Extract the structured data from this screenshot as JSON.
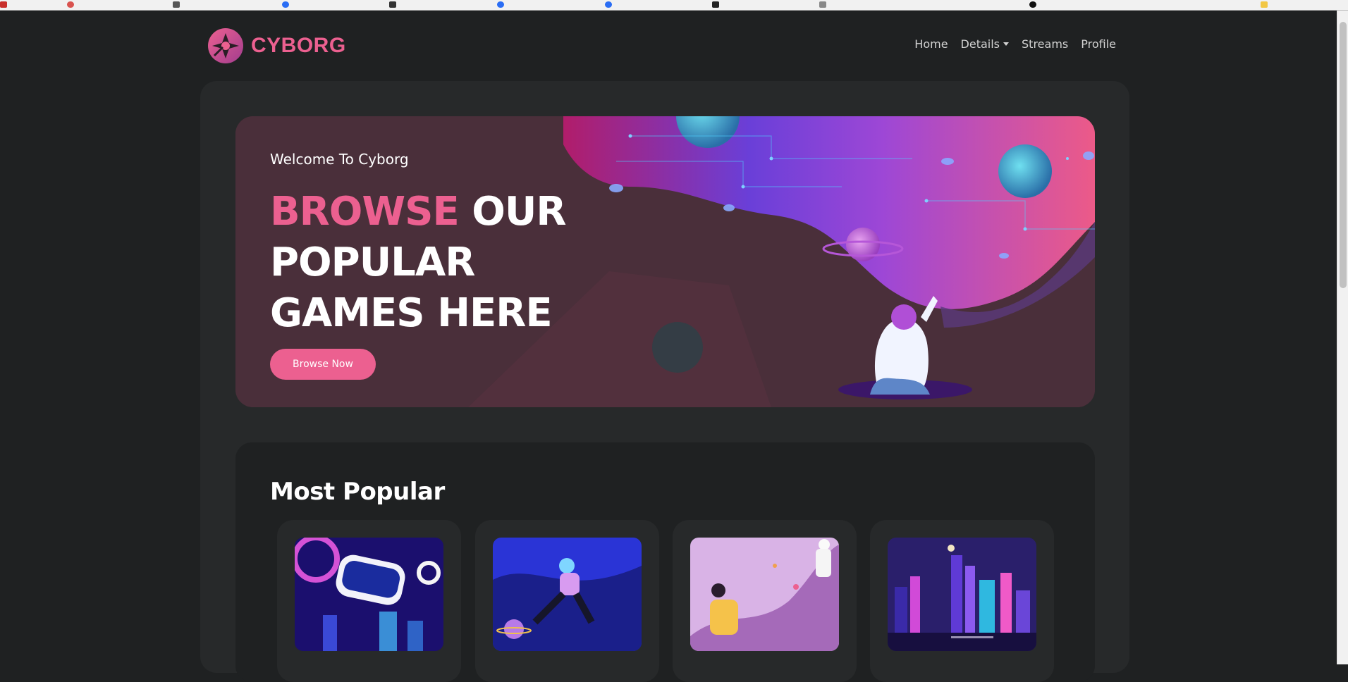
{
  "brand": {
    "name": "CYBORG",
    "accent_color": "#ec6090",
    "logo_icon": "cyborg-logo-icon"
  },
  "nav": {
    "items": [
      {
        "label": "Home"
      },
      {
        "label": "Details",
        "has_dropdown": true
      },
      {
        "label": "Streams"
      },
      {
        "label": "Profile"
      }
    ]
  },
  "banner": {
    "welcome": "Welcome To Cyborg",
    "title_accent": "BROWSE",
    "title_rest": "OUR POPULAR GAMES HERE",
    "button_label": "Browse Now",
    "illustration": "vr-space-explorer-illustration"
  },
  "popular": {
    "heading": "Most Popular",
    "games": [
      {
        "thumb": "vr-headset-artwork"
      },
      {
        "thumb": "floating-vr-girl-artwork"
      },
      {
        "thumb": "vr-astronaut-artwork"
      },
      {
        "thumb": "neon-city-artwork"
      }
    ]
  },
  "colors": {
    "page_bg": "#1f2122",
    "content_bg": "#27292a",
    "accent": "#ec6090"
  }
}
